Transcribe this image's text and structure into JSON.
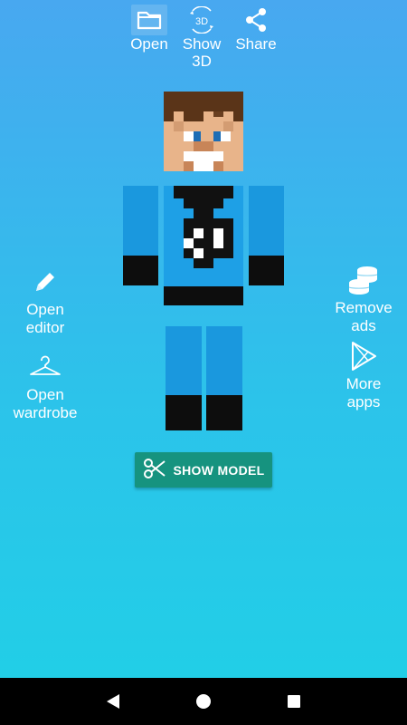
{
  "toolbar": {
    "open_label": "Open",
    "show3d_label_line1": "Show",
    "show3d_label_line2": "3D",
    "share_label": "Share"
  },
  "left_actions": {
    "editor_line1": "Open",
    "editor_line2": "editor",
    "wardrobe_line1": "Open",
    "wardrobe_line2": "wardrobe"
  },
  "right_actions": {
    "remove_ads_line1": "Remove",
    "remove_ads_line2": "ads",
    "more_apps_line1": "More",
    "more_apps_line2": "apps"
  },
  "show_model_label": "SHOW MODEL",
  "icons": {
    "open": "folder-icon",
    "show3d": "rotate-3d-icon",
    "share": "share-icon",
    "editor": "pencil-icon",
    "wardrobe": "hanger-icon",
    "remove_ads": "coins-icon",
    "more_apps": "play-store-icon",
    "show_model": "scissors-icon",
    "nav_back": "back-icon",
    "nav_home": "home-icon",
    "nav_recents": "recents-icon"
  },
  "colors": {
    "button_bg": "#16937f",
    "shirt_blue": "#1ea0e6",
    "navbar_bg": "#000000"
  }
}
